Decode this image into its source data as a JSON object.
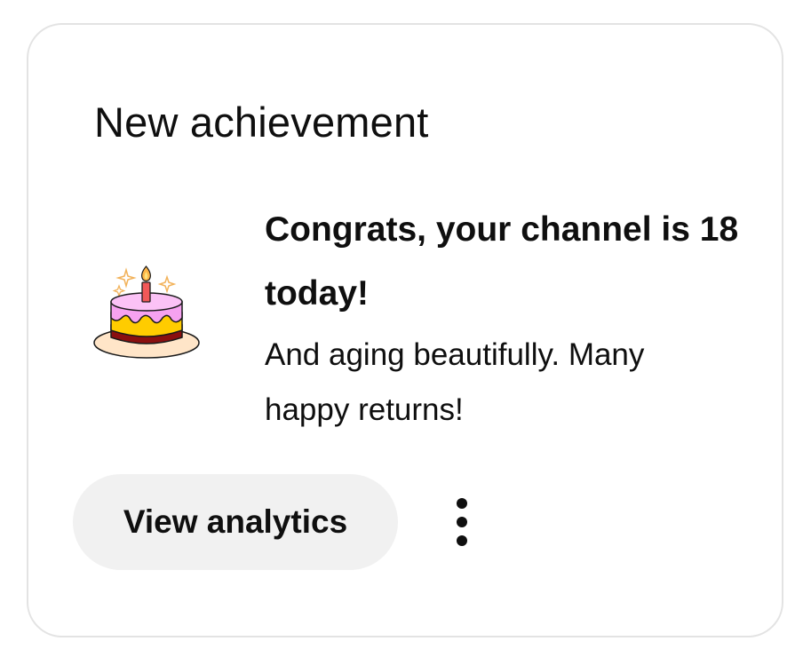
{
  "card": {
    "title": "New achievement",
    "achievement": {
      "icon": "birthday-cake-icon",
      "headline": "Congrats, your channel is 18 today!",
      "subtext": "And aging beautifully. Many happy returns!"
    },
    "actions": {
      "primary_label": "View analytics",
      "more_icon": "more-vertical-icon"
    }
  },
  "colors": {
    "card_border": "#e3e3e3",
    "button_background": "#f1f1f1",
    "text": "#0f0f0f",
    "cake_frosting": "#f6a2f0",
    "cake_band": "#ffcc00",
    "cake_base": "#8a0f0f",
    "candle": "#f15858",
    "plate": "#ffe5c8"
  }
}
